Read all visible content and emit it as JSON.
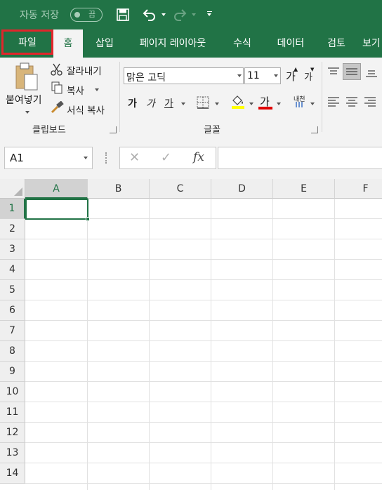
{
  "titlebar": {
    "autosave_label": "자동 저장",
    "autosave_state": "끔",
    "icons": [
      "save-icon",
      "undo-icon",
      "redo-icon",
      "customize-qat-icon"
    ]
  },
  "tabs": [
    {
      "label": "파일",
      "highlighted": true
    },
    {
      "label": "홈",
      "active": true
    },
    {
      "label": "삽입"
    },
    {
      "label": "페이지 레이아웃"
    },
    {
      "label": "수식"
    },
    {
      "label": "데이터"
    },
    {
      "label": "검토"
    },
    {
      "label": "보기"
    }
  ],
  "ribbon": {
    "clipboard": {
      "paste_label": "붙여넣기",
      "cut_label": "잘라내기",
      "copy_label": "복사",
      "format_painter_label": "서식 복사",
      "group_label": "클립보드"
    },
    "font": {
      "font_name": "맑은 고딕",
      "font_size": "11",
      "grow_label": "가",
      "shrink_label": "가",
      "bold_label": "가",
      "italic_label": "가",
      "underline_label": "가",
      "font_color_label": "가",
      "phonetic_label": "내천",
      "group_label": "글꼴"
    }
  },
  "formula_bar": {
    "name_box": "A1",
    "cancel_label": "✕",
    "enter_label": "✓",
    "fx_label": "fx",
    "formula": ""
  },
  "grid": {
    "columns": [
      "A",
      "B",
      "C",
      "D",
      "E",
      "F"
    ],
    "rows": [
      "1",
      "2",
      "3",
      "4",
      "5",
      "6",
      "7",
      "8",
      "9",
      "10",
      "11",
      "12",
      "13",
      "14"
    ],
    "selected_cell": "A1"
  },
  "colors": {
    "brand": "#217346",
    "highlight_border": "#e3252b",
    "fill_color": "#ffff00",
    "font_color": "#e00000"
  }
}
